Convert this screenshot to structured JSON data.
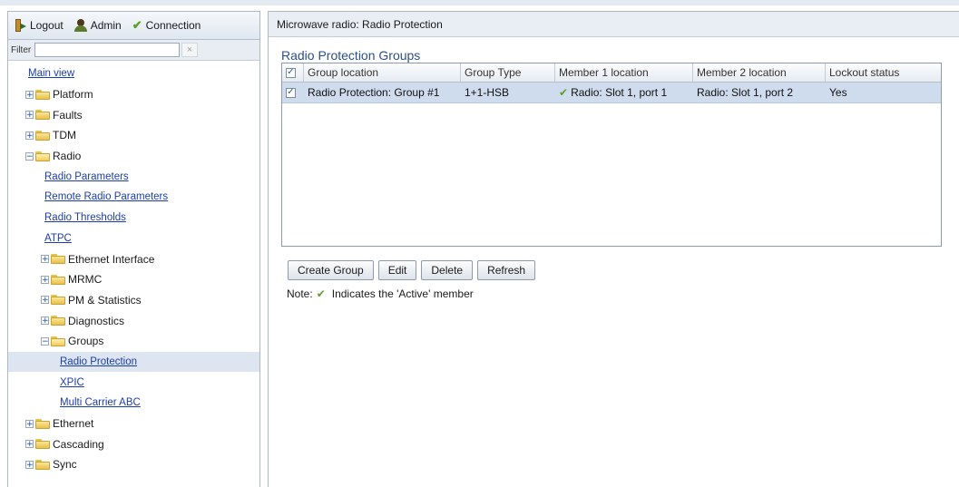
{
  "topbar": {
    "logout_label": "Logout",
    "admin_label": "Admin",
    "connection_label": "Connection"
  },
  "filter": {
    "label": "Filter",
    "value": "",
    "clear_glyph": "×"
  },
  "tree": {
    "main_view": "Main view",
    "platform": "Platform",
    "faults": "Faults",
    "tdm": "TDM",
    "radio": "Radio",
    "radio_parameters": "Radio Parameters",
    "remote_radio_parameters": "Remote Radio Parameters",
    "radio_thresholds": "Radio Thresholds",
    "atpc": "ATPC",
    "ethernet_interface": "Ethernet Interface",
    "mrmc": "MRMC",
    "pm_statistics": "PM & Statistics",
    "diagnostics": "Diagnostics",
    "groups": "Groups",
    "radio_protection": "Radio Protection",
    "xpic": "XPIC",
    "multi_carrier_abc": "Multi Carrier ABC",
    "ethernet": "Ethernet",
    "cascading": "Cascading",
    "sync": "Sync"
  },
  "main": {
    "window_title": "Microwave radio: Radio Protection",
    "section_title": "Radio Protection Groups",
    "columns": [
      "Group location",
      "Group Type",
      "Member 1 location",
      "Member 2 location",
      "Lockout status"
    ],
    "rows": [
      {
        "group_location": "Radio Protection: Group #1",
        "group_type": "1+1-HSB",
        "member1": "Radio: Slot 1, port 1",
        "member2": "Radio: Slot 1, port 2",
        "lockout": "Yes"
      }
    ],
    "buttons": {
      "create": "Create Group",
      "edit": "Edit",
      "delete": "Delete",
      "refresh": "Refresh"
    },
    "note_prefix": "Note:",
    "note_text": "Indicates the 'Active' member"
  },
  "colors": {
    "accent": "#2a4f86",
    "link": "#1c3ea8",
    "selected_row": "#cfdcee",
    "active_check": "#5aa02c"
  }
}
